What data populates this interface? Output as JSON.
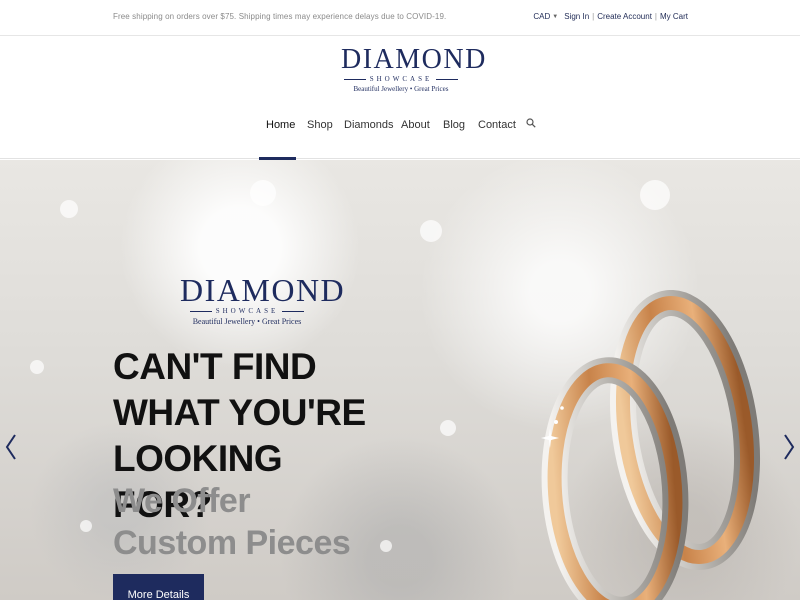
{
  "topbar": {
    "promo": "Free shipping on orders over $75. Shipping times may experience delays due to COVID-19.",
    "currency": "CAD",
    "sign_in": "Sign In",
    "create_account": "Create Account",
    "my_cart": "My Cart",
    "separator": "|"
  },
  "brand": {
    "name": "DIAMOND",
    "subtitle": "SHOWCASE",
    "tagline": "Beautiful Jewellery • Great Prices",
    "color": "#1e2b5e"
  },
  "nav": {
    "items": [
      "Home",
      "Shop",
      "Diamonds",
      "About",
      "Blog",
      "Contact"
    ],
    "active": "Home",
    "search_icon": "search-icon"
  },
  "hero": {
    "headline": "CAN'T FIND WHAT YOU'RE LOOKING FOR?",
    "subline": "We Offer Custom Pieces",
    "cta": "More Details",
    "prev_icon": "chevron-left-icon",
    "next_icon": "chevron-right-icon"
  }
}
